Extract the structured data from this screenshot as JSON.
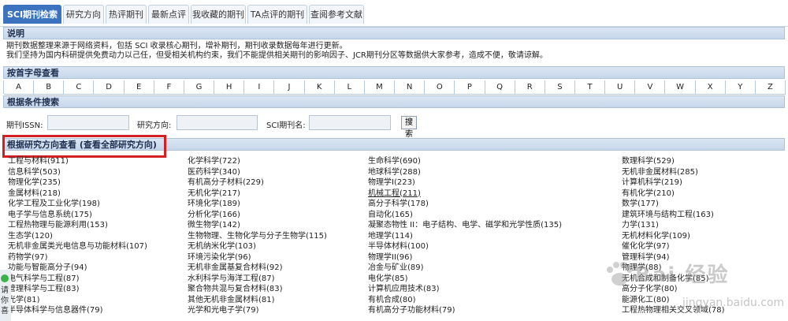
{
  "tabs": [
    {
      "label": "SCI期刊检索",
      "active": true
    },
    {
      "label": "研究方向",
      "active": false
    },
    {
      "label": "热评期刊",
      "active": false
    },
    {
      "label": "最新点评",
      "active": false
    },
    {
      "label": "我收藏的期刊",
      "active": false
    },
    {
      "label": "TA点评的期刊",
      "active": false
    },
    {
      "label": "查阅参考文献",
      "active": false
    }
  ],
  "sections": {
    "description_title": "说明",
    "description_line1": "期刊数据整理来源于网络资料，包括 SCI 收录核心期刊，增补期刊，期刊收录数据每年进行更新。",
    "description_line2": "我们坚持为国内科研提供免费动力以己任，但受相关机构约束，我们不能提供相关期刊的影响因子、JCR期刊分区等数据供大家参考，造成不便，敬请谅解。",
    "letter_title": "按首字母查看",
    "search_title": "根据条件搜索",
    "direction_title": "根据研究方向查看 (查看全部研究方向)"
  },
  "letters": [
    "A",
    "B",
    "C",
    "D",
    "E",
    "F",
    "G",
    "H",
    "I",
    "J",
    "K",
    "L",
    "M",
    "N",
    "O",
    "P",
    "Q",
    "R",
    "S",
    "T",
    "U",
    "V",
    "W",
    "X",
    "Y",
    "Z"
  ],
  "search": {
    "issn_label": "期刊ISSN:",
    "direction_label": "研究方向:",
    "name_label": "SCI期刊名:",
    "button": "搜索"
  },
  "directions": [
    [
      "工程与材料(911)",
      "化学科学(722)",
      "生命科学(690)",
      "数理科学(529)"
    ],
    [
      "信息科学(503)",
      "医药科学(340)",
      "地球科学(288)",
      "无机非金属材料(285)"
    ],
    [
      "物理化学(235)",
      "有机高分子材料(229)",
      "物理学I(223)",
      "计算机科学(219)"
    ],
    [
      "金属材料(218)",
      "无机化学(217)",
      "机械工程(211)",
      "有机化学(210)"
    ],
    [
      "化学工程及工业化学(198)",
      "环境化学(189)",
      "高分子科学(178)",
      "数学(177)"
    ],
    [
      "电子学与信息系统(175)",
      "分析化学(166)",
      "自动化(165)",
      "建筑环境与结构工程(163)"
    ],
    [
      "工程热物理与能源利用(153)",
      "微生物学(142)",
      "凝聚态物性 II：电子结构、电学、磁学和光学性质(135)",
      "力学(131)"
    ],
    [
      "生态学(120)",
      "生物物理、生物化学与分子生物学(115)",
      "地理学(114)",
      "无机材料化学(109)"
    ],
    [
      "无机非金属类光电信息与功能材料(107)",
      "无机纳米化学(103)",
      "半导体材料(100)",
      "催化化学(97)"
    ],
    [
      "药物学(97)",
      "环境污染化学(96)",
      "物理学II(96)",
      "管理科学(94)"
    ],
    [
      "功能与智能高分子(94)",
      "无机非金属基复合材料(92)",
      "冶金与矿业(89)",
      "物理学(88)"
    ],
    [
      "电气科学与工程(87)",
      "水利科学与海洋工程(87)",
      "电化学(85)",
      "无机合成和制备化学(85)"
    ],
    [
      "管理科学与工程(83)",
      "聚合物共混与复合材料(83)",
      "计算机应用技术(83)",
      "高分子化学(80)"
    ],
    [
      "光学(81)",
      "其他无机非金属材料(81)",
      "有机合成(80)",
      "能源化工(80)"
    ],
    [
      "半导体科学与信息器件(79)",
      "光学和光电子学(79)",
      "有机高分子功能材料(79)",
      "工程热物理相关交叉领域(78)"
    ]
  ],
  "sidebar": {
    "text": "请你喜"
  },
  "watermark": {
    "text": "Bai 经验",
    "url": "jingyan.baidu.com"
  },
  "colors": {
    "tab_active": "#3c73bf",
    "section_bar": "#c6d6ea",
    "highlight_box": "#d42020"
  }
}
